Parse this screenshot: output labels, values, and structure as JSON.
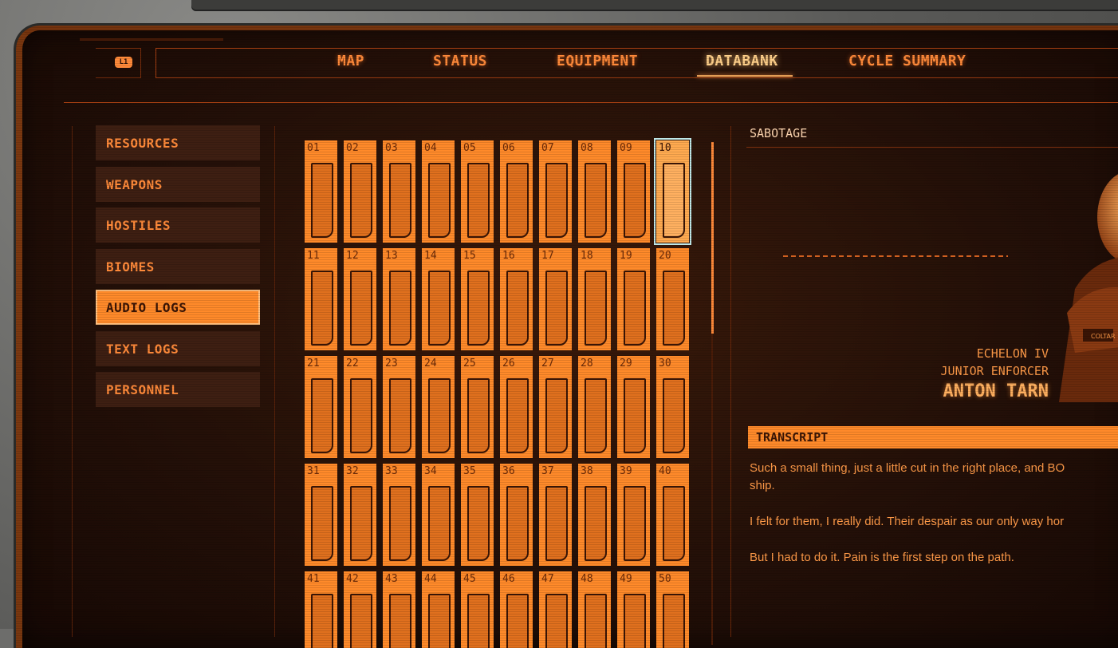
{
  "window": {
    "controller_badge": "L1"
  },
  "tabs": [
    {
      "label": "MAP",
      "active": false
    },
    {
      "label": "STATUS",
      "active": false
    },
    {
      "label": "EQUIPMENT",
      "active": false
    },
    {
      "label": "DATABANK",
      "active": true
    },
    {
      "label": "CYCLE SUMMARY",
      "active": false
    }
  ],
  "sidebar": {
    "items": [
      {
        "label": "RESOURCES",
        "active": false
      },
      {
        "label": "WEAPONS",
        "active": false
      },
      {
        "label": "HOSTILES",
        "active": false
      },
      {
        "label": "BIOMES",
        "active": false
      },
      {
        "label": "AUDIO LOGS",
        "active": true
      },
      {
        "label": "TEXT LOGS",
        "active": false
      },
      {
        "label": "PERSONNEL",
        "active": false
      }
    ]
  },
  "grid": {
    "slots": [
      "01",
      "02",
      "03",
      "04",
      "05",
      "06",
      "07",
      "08",
      "09",
      "10",
      "11",
      "12",
      "13",
      "14",
      "15",
      "16",
      "17",
      "18",
      "19",
      "20",
      "21",
      "22",
      "23",
      "24",
      "25",
      "26",
      "27",
      "28",
      "29",
      "30",
      "31",
      "32",
      "33",
      "34",
      "35",
      "36",
      "37",
      "38",
      "39",
      "40",
      "41",
      "42",
      "43",
      "44",
      "45",
      "46",
      "47",
      "48",
      "49",
      "50"
    ],
    "selected": "10"
  },
  "log": {
    "title": "SABOTAGE",
    "speaker_org": "ECHELON IV",
    "speaker_rank": "JUNIOR ENFORCER",
    "speaker_name": "ANTON TARN",
    "portrait_badge": "COLTAR",
    "transcript_header": "TRANSCRIPT",
    "paragraphs": [
      "Such a small thing, just a little cut in the right place, and BO",
      "ship.",
      "I felt for them, I really did. Their despair as our only way hor",
      "But I had to do it. Pain is the first step on the path."
    ]
  },
  "colors": {
    "accent": "#ff8a2a",
    "text": "#ff9a48",
    "background": "#241008",
    "selection": "#bfe8e8"
  }
}
